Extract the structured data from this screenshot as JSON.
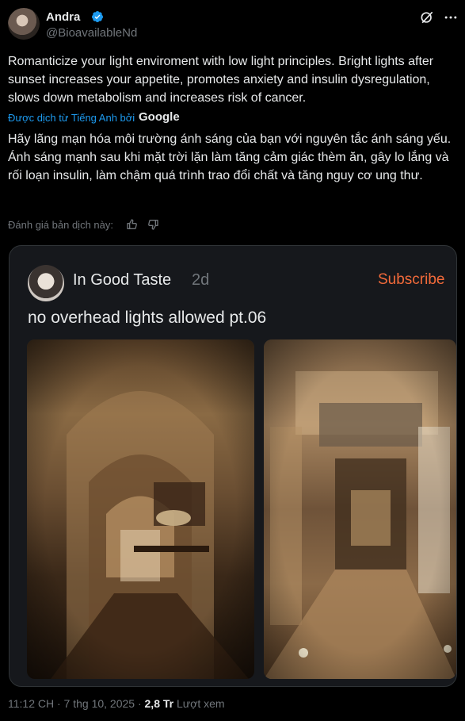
{
  "author": {
    "name": "Andra",
    "handle": "@BioavailableNd",
    "avatar_icon": "profile-avatar",
    "verified_icon": "verified-badge-icon",
    "verified_color": "#1d9bf0"
  },
  "tweet": {
    "text": "Romanticize your light enviroment with low light principles. Bright lights after sunset increases your appetite, promotes anxiety and insulin dysregulation, slows down metabolism and increases risk of cancer.",
    "translated_by": "Được dịch từ Tiếng Anh bởi",
    "translator": "Google",
    "translation": "Hãy lãng mạn hóa môi trường ánh sáng của bạn với nguyên tắc ánh sáng yếu. Ánh sáng mạnh sau khi mặt trời lặn làm tăng cảm giác thèm ăn, gây lo lắng và rối loạn insulin, làm chậm quá trình trao đổi chất và tăng nguy cơ ung thư.",
    "rate_translation": "Đánh giá bản dịch này:"
  },
  "card": {
    "name": "In Good Taste",
    "time": "2d",
    "subscribe": "Subscribe",
    "caption": "no overhead lights allowed pt.06",
    "accent_color": "#f26a3a"
  },
  "footer": {
    "time": "11:12 CH · 7 thg 10, 2025 · ",
    "views": "2,8 Tr",
    "views_label": " Lượt xem"
  },
  "icons": {
    "grok": "grok-icon",
    "more": "more-options-icon",
    "thumb_up": "thumbs-up-icon",
    "thumb_down": "thumbs-down-icon"
  }
}
